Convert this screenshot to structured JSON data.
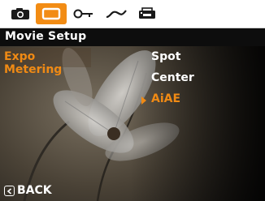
{
  "tabs": [
    {
      "name": "camera-icon",
      "active": false
    },
    {
      "name": "movie-icon",
      "active": true
    },
    {
      "name": "key-icon",
      "active": false
    },
    {
      "name": "wave-icon",
      "active": false
    },
    {
      "name": "printer-icon",
      "active": false
    }
  ],
  "header": {
    "title": "Movie Setup"
  },
  "category": {
    "label": "Expo Metering"
  },
  "options": [
    {
      "label": "Spot",
      "selected": false
    },
    {
      "label": "Center",
      "selected": false
    },
    {
      "label": "AiAE",
      "selected": true
    }
  ],
  "back": {
    "label": "BACK"
  },
  "colors": {
    "accent": "#f08a14",
    "tab_bar": "#ffffff",
    "text": "#ffffff"
  }
}
